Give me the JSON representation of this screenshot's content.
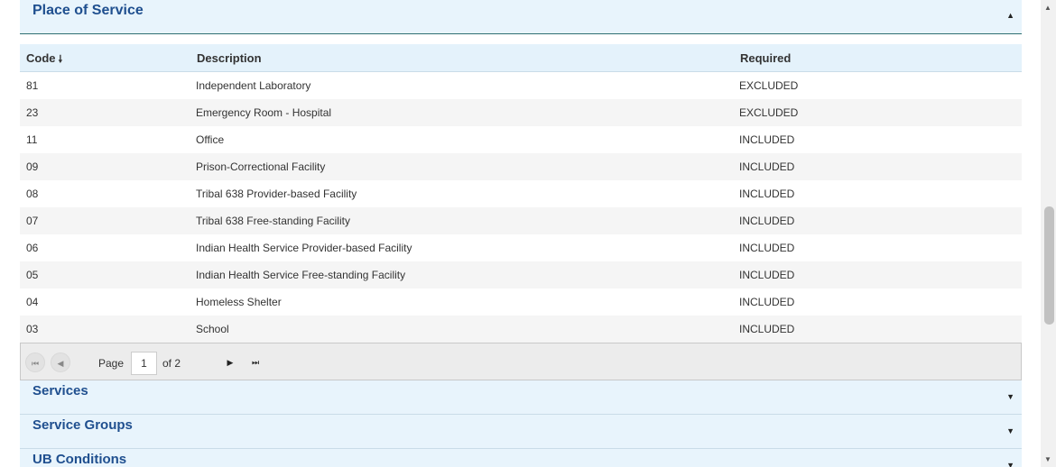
{
  "place_of_service": {
    "title": "Place of Service",
    "toggle_icon": "▲"
  },
  "table": {
    "headers": {
      "code": "Code",
      "description": "Description",
      "required": "Required"
    },
    "sort_icon": "🠗",
    "rows": [
      {
        "code": "81",
        "description": "Independent Laboratory",
        "required": "EXCLUDED"
      },
      {
        "code": "23",
        "description": "Emergency Room - Hospital",
        "required": "EXCLUDED"
      },
      {
        "code": "11",
        "description": "Office",
        "required": "INCLUDED"
      },
      {
        "code": "09",
        "description": "Prison-Correctional Facility",
        "required": "INCLUDED"
      },
      {
        "code": "08",
        "description": "Tribal 638 Provider-based Facility",
        "required": "INCLUDED"
      },
      {
        "code": "07",
        "description": "Tribal 638 Free-standing Facility",
        "required": "INCLUDED"
      },
      {
        "code": "06",
        "description": "Indian Health Service Provider-based Facility",
        "required": "INCLUDED"
      },
      {
        "code": "05",
        "description": "Indian Health Service Free-standing Facility",
        "required": "INCLUDED"
      },
      {
        "code": "04",
        "description": "Homeless Shelter",
        "required": "INCLUDED"
      },
      {
        "code": "03",
        "description": "School",
        "required": "INCLUDED"
      }
    ]
  },
  "pager": {
    "page_label": "Page",
    "current_page": "1",
    "of_label": "of 2",
    "first_icon": "⏮",
    "prev_icon": "◀",
    "next_icon": "▶",
    "last_icon": "⏭"
  },
  "accordions": {
    "services": {
      "title": "Services",
      "arrow": "▼"
    },
    "service_groups": {
      "title": "Service Groups",
      "arrow": "▼"
    },
    "ub_conditions": {
      "title": "UB Conditions",
      "arrow": "▼"
    }
  },
  "scrollbar": {
    "up_icon": "▲",
    "down_icon": "▼"
  }
}
